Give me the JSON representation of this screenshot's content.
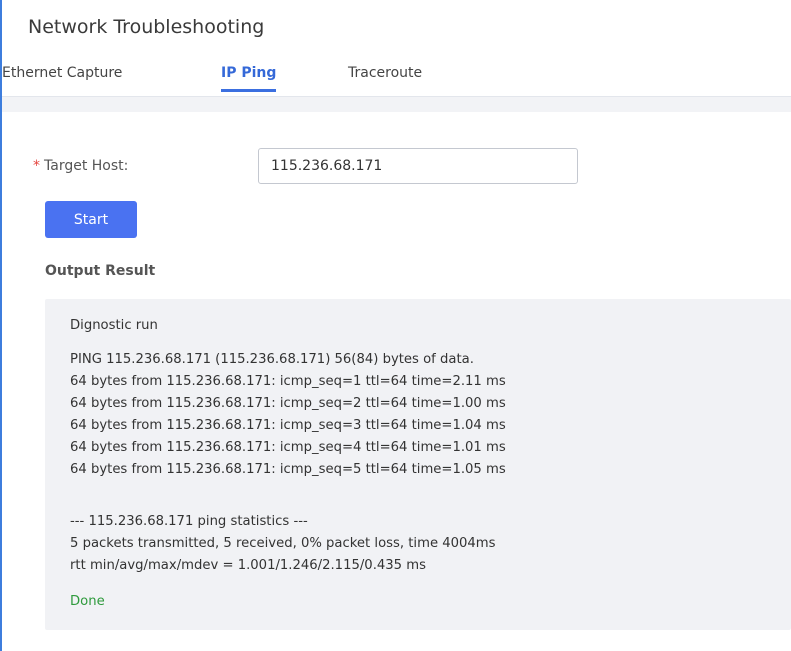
{
  "page": {
    "title": "Network Troubleshooting"
  },
  "tabs": [
    {
      "label": "Ethernet Capture",
      "active": false
    },
    {
      "label": "IP Ping",
      "active": true
    },
    {
      "label": "Traceroute",
      "active": false
    }
  ],
  "form": {
    "required_mark": "*",
    "target_host_label": "Target Host:",
    "target_host_value": "115.236.68.171",
    "start_label": "Start"
  },
  "output": {
    "section_title": "Output Result",
    "run_label": "Dignostic run",
    "lines": [
      "PING 115.236.68.171 (115.236.68.171) 56(84) bytes of data.",
      "64 bytes from 115.236.68.171: icmp_seq=1 ttl=64 time=2.11 ms",
      "64 bytes from 115.236.68.171: icmp_seq=2 ttl=64 time=1.00 ms",
      "64 bytes from 115.236.68.171: icmp_seq=3 ttl=64 time=1.04 ms",
      "64 bytes from 115.236.68.171: icmp_seq=4 ttl=64 time=1.01 ms",
      "64 bytes from 115.236.68.171: icmp_seq=5 ttl=64 time=1.05 ms"
    ],
    "stats_lines": [
      "--- 115.236.68.171 ping statistics ---",
      "5 packets transmitted, 5 received, 0% packet loss, time 4004ms",
      "rtt min/avg/max/mdev = 1.001/1.246/2.115/0.435 ms"
    ],
    "status": "Done"
  },
  "colors": {
    "accent": "#4a72f1",
    "active_tab": "#3569d8",
    "required": "#e5453e",
    "done": "#2e9a3c",
    "output_bg": "#f1f2f5"
  }
}
